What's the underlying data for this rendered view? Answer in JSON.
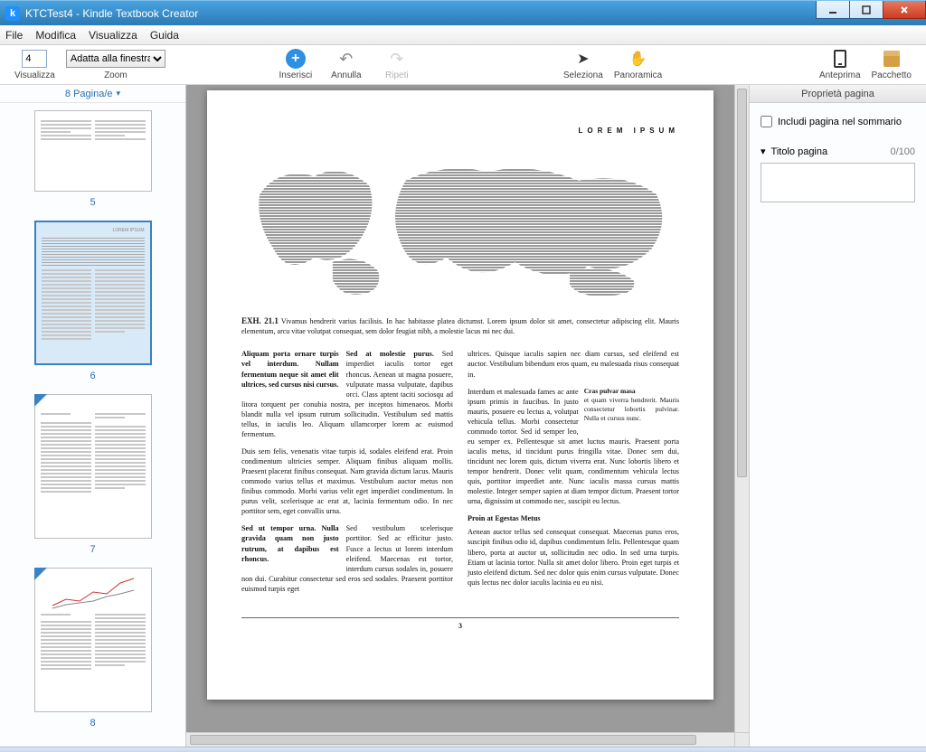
{
  "window": {
    "title": "KTCTest4 - Kindle Textbook Creator"
  },
  "menu": {
    "file": "File",
    "edit": "Modifica",
    "view": "Visualizza",
    "help": "Guida"
  },
  "toolbar": {
    "view_label": "Visualizza",
    "zoom_label": "Zoom",
    "zoom_value": "4",
    "zoom_fit": "Adatta alla finestra",
    "insert": "Inserisci",
    "undo": "Annulla",
    "redo": "Ripeti",
    "select": "Seleziona",
    "pan": "Panoramica",
    "preview": "Anteprima",
    "package": "Pacchetto"
  },
  "thumbs": {
    "header": "8 Pagina/e",
    "p5": "5",
    "p6": "6",
    "p7": "7",
    "p8": "8"
  },
  "properties": {
    "header": "Proprietà pagina",
    "include_toc": "Includi pagina nel sommario",
    "page_title": "Titolo pagina",
    "counter": "0/100"
  },
  "page": {
    "running_head": "LOREM IPSUM",
    "exh_label": "EXH. 21.1",
    "exh_text": "Vivamus hendrerit varius facilisis. In hac habitasse platea dictumst. Lorem ipsum dolor sit amet, consectetur adipiscing elit. Mauris elementum, arcu vitae volutpat consequat, sem dolor feugiat nibh, a molestie lacus mi nec dui.",
    "col1_bold1": "Aliquam porta ornare turpis vel interdum. Nullam fermentum neque sit amet elit ultrices, sed cursus nisi cursus.",
    "col1_p1_lead": "Sed at molestie purus.",
    "col1_p1": " Sed imperdiet iaculis tortor eget rhoncus. Aenean ut magna posuere, vulputate massa vulputate, dapibus orci. Class aptent taciti sociosqu ad litora torquent per conubia nostra, per inceptos himenaeos. Morbi blandit nulla vel ipsum rutrum sollicitudin. Vestibulum sed mattis tellus, in iaculis leo. Aliquam ullamcorper lorem ac euismod fermentum.",
    "col1_p2": "Duis sem felis, venenatis vitae turpis id, sodales eleifend erat. Proin condimentum ultricies semper. Aliquam finibus aliquam mollis. Praesent placerat finibus consequat. Nam gravida dictum lacus. Mauris commodo varius tellus et maximus. Vestibulum auctor metus non finibus commodo. Morbi varius velit eget imperdiet condimentum. In purus velit, scelerisque ac erat at, lacinia fermentum odio. In nec porttitor sem, eget convallis urna.",
    "col1_bold2": "Sed ut tempor urna. Nulla gravida quam non justo rutrum, at dapibus est rhoncus.",
    "col1_p3": "Sed vestibulum scelerisque porttitor. Sed ac efficitur justo. Fusce a lectus ut lorem interdum eleifend. Maecenas est tortor, interdum cursus sodales in, posuere non dui. Curabitur consectetur sed eros sed sodales. Praesent porttitor euismod turpis eget",
    "col2_p1": "ultrices. Quisque iaculis sapien nec diam cursus, sed eleifend est auctor. Vestibulum bibendum eros quam, eu malesuada risus consequat in.",
    "col2_float_head": "Cras pulvar masa",
    "col2_float_body": "et quam viverra hendrerit. Mauris consectetur lobortis pulvinar. Nulla et cursus nunc.",
    "col2_p2": "Interdum et malesuada fames ac ante ipsum primis in faucibus. In justo mauris, posuere eu lectus a, volutpat vehicula tellus. Morbi consectetur commodo tortor. Sed id semper leo, eu semper ex. Pellentesque sit amet luctus mauris. Praesent porta iaculis metus, id tincidunt purus fringilla vitae. Donec sem dui, tincidunt nec lorem quis, dictum viverra erat. Nunc lobortis libero et tempor hendrerit. Donec velit quam, condimentum vehicula lectus quis, porttitor imperdiet ante. Nunc iaculis massa cursus mattis molestie. Integer semper sapien at diam tempor dictum. Praesent tortor urna, dignissim ut commodo nec, suscipit eu lectus.",
    "col2_sub": "Proin at Egestas Metus",
    "col2_p3": "Aenean auctor tellus sed consequat consequat. Maecenas purus eros, suscipit finibus odio id, dapibus condimentum felis. Pellentesque quam libero, porta at auctor ut, sollicitudin nec odio. In sed urna turpis. Etiam ut lacinia tortor. Nulla sit amet dolor libero. Proin eget turpis et justo eleifend dictum. Sed nec dolor quis enim cursus vulputate. Donec quis lectus nec dolor iaculis lacinia eu eu nisi.",
    "page_number": "3"
  }
}
